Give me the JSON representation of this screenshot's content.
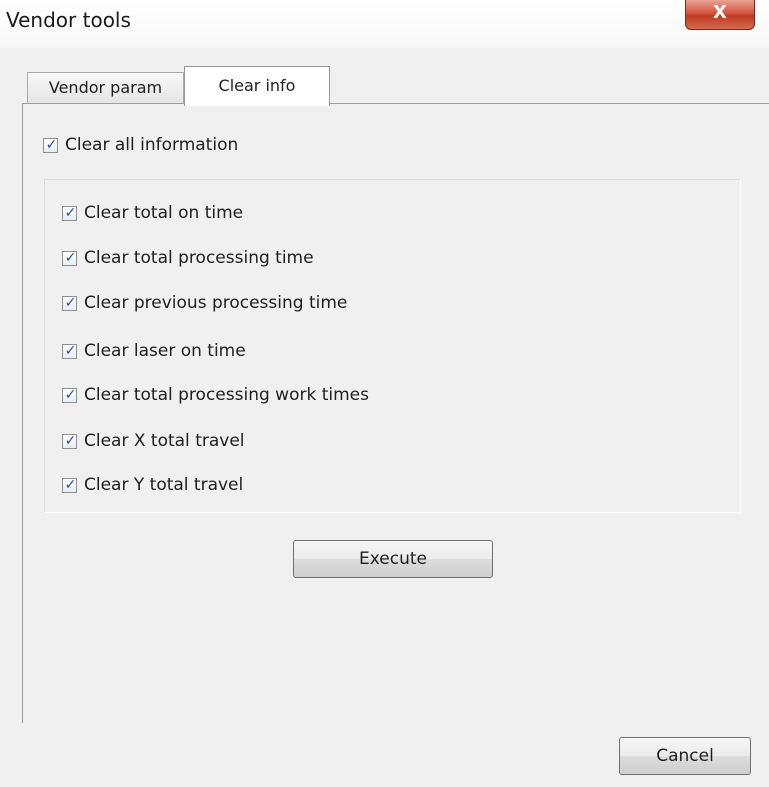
{
  "window": {
    "title": "Vendor tools",
    "close_label": "X"
  },
  "tabs": [
    {
      "label": "Vendor param",
      "active": false
    },
    {
      "label": "Clear info",
      "active": true
    }
  ],
  "clear_all": {
    "label": "Clear all information",
    "checked": true
  },
  "options": [
    {
      "label": "Clear total on time",
      "checked": true
    },
    {
      "label": "Clear total processing time",
      "checked": true
    },
    {
      "label": "Clear previous processing time",
      "checked": true
    },
    {
      "label": "Clear laser on time",
      "checked": true
    },
    {
      "label": "Clear total processing work times",
      "checked": true
    },
    {
      "label": "Clear X total travel",
      "checked": true
    },
    {
      "label": "Clear Y total travel",
      "checked": true
    }
  ],
  "buttons": {
    "execute": "Execute",
    "cancel": "Cancel"
  },
  "check_mark": "✓"
}
